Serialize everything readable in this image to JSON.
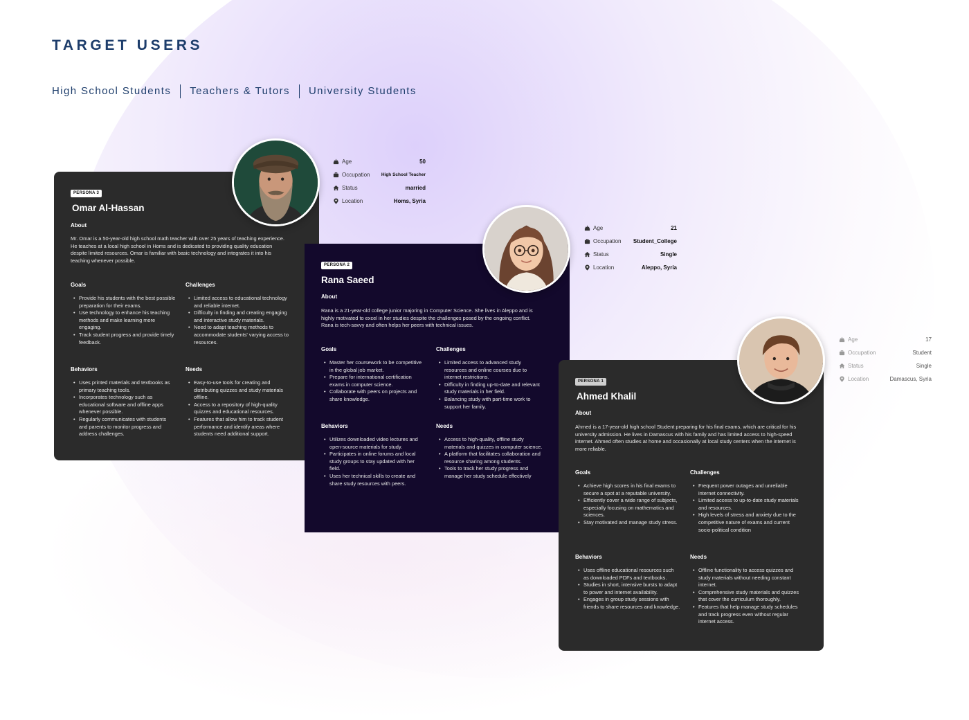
{
  "page": {
    "title": "TARGET USERS",
    "tabs": [
      "High School Students",
      "Teachers & Tutors",
      "University Students"
    ]
  },
  "labels": {
    "about": "About",
    "goals": "Goals",
    "challenges": "Challenges",
    "behaviors": "Behaviors",
    "needs": "Needs",
    "age": "Age",
    "occupation": "Occupation",
    "status": "Status",
    "location": "Location"
  },
  "personas": [
    {
      "badge": "PERSONA 3",
      "name": "Omar Al-Hassan",
      "about": "Mr. Omar is a 50-year-old high school math teacher with over 25 years of teaching experience. He teaches at a local high school in Homs and is dedicated to providing quality education despite limited resources. Omar is familiar with basic technology and integrates it into his teaching whenever possible.",
      "goals": [
        "Provide his students with the best possible preparation for their exams.",
        "Use technology to enhance his teaching methods and make learning more engaging.",
        "Track student progress and provide timely feedback."
      ],
      "challenges": [
        "Limited access to educational technology and reliable internet.",
        "Difficulty in finding and creating engaging and interactive study materials.",
        "Need to adapt teaching methods to accommodate students' varying access to resources."
      ],
      "behaviors": [
        "Uses printed materials and textbooks as primary teaching tools.",
        "Incorporates technology such as educational software and offline apps whenever possible.",
        "Regularly communicates with students and parents to monitor progress and address challenges."
      ],
      "needs": [
        "Easy-to-use tools for creating and distributing quizzes and study materials offline.",
        "Access to a repository of high-quality quizzes and educational resources.",
        "Features that allow him to track student performance and identify areas where students need additional support."
      ],
      "info": {
        "age": "50",
        "occupation": "High School Teacher",
        "status": "married",
        "location": "Homs, Syria"
      }
    },
    {
      "badge": "PERSONA 2",
      "name": "Rana Saeed",
      "about": "Rana is a 21-year-old college junior majoring in Computer Science. She lives in Aleppo and is highly motivated to excel in her studies despite the challenges posed by the ongoing conflict. Rana is tech-savvy and often helps her peers with technical issues.",
      "goals": [
        "Master her coursework to be competitive in the global job market.",
        "Prepare for international certification exams in computer science.",
        "Collaborate with peers on projects and share knowledge."
      ],
      "challenges": [
        "Limited access to advanced study resources and online courses due to internet restrictions.",
        "Difficulty in finding up-to-date and relevant study materials in her field.",
        "Balancing study with part-time work to support her family."
      ],
      "behaviors": [
        "Utilizes downloaded video lectures and open-source materials for study.",
        "Participates in online forums and local study groups to stay updated with her field.",
        "Uses her technical skills to create and share study resources with peers."
      ],
      "needs": [
        "Access to high-quality, offline study materials and quizzes in computer science.",
        "A platform that facilitates collaboration and resource sharing among students.",
        "Tools to track her study progress and manage her study schedule effectively"
      ],
      "info": {
        "age": "21",
        "occupation": "Student_College",
        "status": "Single",
        "location": "Aleppo, Syria"
      }
    },
    {
      "badge": "PERSONA 1",
      "name": "Ahmed Khalil",
      "about": "Ahmed is a 17-year-old high school  Student preparing for his final exams, which are critical for his university admission. He lives in Damascus with his family and has limited access to high-speed internet. Ahmed often studies at home and occasionally at local study centers when the internet is more reliable.",
      "goals": [
        "Achieve high scores in his final exams to secure a spot at a reputable university.",
        "Efficiently cover a wide range of subjects, especially focusing on mathematics and sciences.",
        "Stay motivated and manage study stress."
      ],
      "challenges": [
        "Frequent power outages and unreliable internet connectivity.",
        "Limited access to up-to-date study materials and resources.",
        "High levels of stress and anxiety due to the competitive nature of exams and current socio-political condition"
      ],
      "behaviors": [
        "Uses offline educational resources such as downloaded PDFs and textbooks.",
        "Studies in short, intensive bursts to adapt to power and internet availability.",
        "Engages in group study sessions with friends to share resources and knowledge."
      ],
      "needs": [
        "Offline functionality to access quizzes and study materials without needing constant internet.",
        "Comprehensive study materials and quizzes that cover the curriculum thoroughly.",
        "Features that help manage study schedules and track progress even without regular internet access."
      ],
      "info": {
        "age": "17",
        "occupation": "Student",
        "status": "Single",
        "location": "Damascus, Syria"
      }
    }
  ],
  "icons": [
    "birthday-cake-icon",
    "briefcase-icon",
    "home-icon",
    "location-pin-icon"
  ],
  "colors": {
    "title": "#1d3d6b",
    "card_dark": "#2b2b2b",
    "card_navy": "#13092c"
  }
}
